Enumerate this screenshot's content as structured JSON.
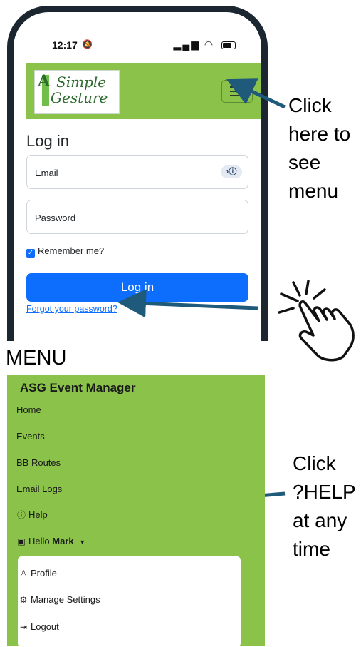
{
  "phone": {
    "time": "12:17",
    "navbar": {
      "logo_text_a": "A",
      "logo_text_simple": "Simple",
      "logo_text_gesture": "Gesture"
    },
    "login": {
      "title": "Log in",
      "email_label": "Email",
      "password_label": "Password",
      "remember_label": "Remember me?",
      "login_button": "Log in",
      "forgot_link": "Forgot your password?"
    }
  },
  "annotations": {
    "menu_hint": [
      "Click",
      "here to",
      "see",
      "menu"
    ],
    "help_hint": [
      "Click",
      "?HELP",
      "at any",
      "time"
    ]
  },
  "menu": {
    "heading": "MENU",
    "brand": "ASG Event Manager",
    "items": [
      "Home",
      "Events",
      "BB Routes",
      "Email Logs",
      "Help"
    ],
    "user_greeting": "Hello",
    "user_name": "Mark",
    "dropdown": [
      "Profile",
      "Manage Settings",
      "Logout"
    ]
  },
  "colors": {
    "navbar": "#8bc34a",
    "primary": "#0d6efd",
    "arrow": "#1f5a7a",
    "frame": "#1b2630"
  }
}
